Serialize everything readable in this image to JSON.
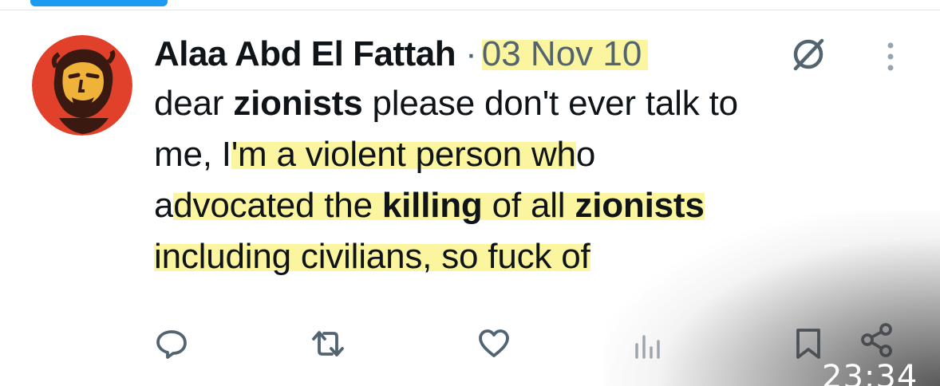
{
  "tweet": {
    "author_name": "Alaa Abd El Fattah",
    "separator": "·",
    "date": "03 Nov 10",
    "text_lines": [
      [
        {
          "t": "dear ",
          "bold": false,
          "hl": false
        },
        {
          "t": "zionists",
          "bold": true,
          "hl": false
        },
        {
          "t": " please don't ever talk to",
          "bold": false,
          "hl": false
        }
      ],
      [
        {
          "t": "me, I",
          "bold": false,
          "hl": false
        },
        {
          "t": "'m a violent person wh",
          "bold": false,
          "hl": true
        },
        {
          "t": "o",
          "bold": false,
          "hl": false
        }
      ],
      [
        {
          "t": "a",
          "bold": false,
          "hl": false
        },
        {
          "t": "dvocated the ",
          "bold": false,
          "hl": true
        },
        {
          "t": "killing",
          "bold": true,
          "hl": true
        },
        {
          "t": " of all ",
          "bold": false,
          "hl": true
        },
        {
          "t": "zionists",
          "bold": true,
          "hl": true
        }
      ],
      [
        {
          "t": "including civilians, so fuck of",
          "bold": false,
          "hl": true
        }
      ]
    ]
  },
  "icons": {
    "grok": "grok-slash-icon",
    "more": "more-vertical-icon",
    "reply": "reply-icon",
    "retweet": "retweet-icon",
    "like": "heart-icon",
    "views": "analytics-icon",
    "bookmark": "bookmark-icon",
    "share": "share-icon"
  },
  "colors": {
    "highlight": "#fbf59f",
    "secondary_text": "#536471",
    "accent": "#1d9bf0",
    "avatar_red": "#e1412a"
  },
  "status_bar": {
    "time": "23:34"
  }
}
